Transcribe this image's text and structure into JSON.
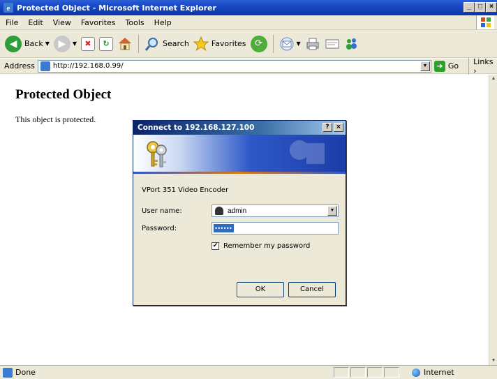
{
  "window": {
    "title": "Protected Object - Microsoft Internet Explorer",
    "controls": [
      "_",
      "□",
      "×"
    ]
  },
  "menu": {
    "items": [
      "File",
      "Edit",
      "View",
      "Favorites",
      "Tools",
      "Help"
    ]
  },
  "toolbar": {
    "back_label": "Back",
    "search_label": "Search",
    "favorites_label": "Favorites"
  },
  "addressbar": {
    "label": "Address",
    "url": "http://192.168.0.99/",
    "go_label": "Go",
    "links_label": "Links"
  },
  "page": {
    "heading": "Protected Object",
    "text": "This object is protected."
  },
  "dialog": {
    "title": "Connect to 192.168.127.100",
    "help_btn": "?",
    "close_btn": "×",
    "description": "VPort 351 Video Encoder",
    "username_label": "User name:",
    "username_value": "admin",
    "password_label": "Password:",
    "password_value": "••••••",
    "remember_label": "Remember my password",
    "remember_checked": true,
    "ok_label": "OK",
    "cancel_label": "Cancel"
  },
  "status": {
    "text": "Done",
    "zone": "Internet"
  },
  "colors": {
    "title_bar": "#0b34a6",
    "chrome": "#ece9d8",
    "selection": "#316ac5"
  }
}
